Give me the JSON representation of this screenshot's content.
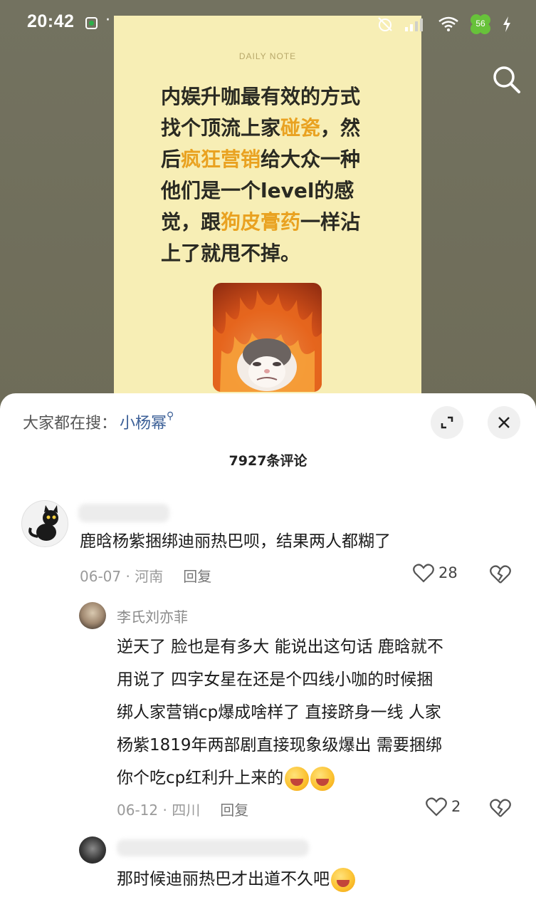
{
  "status_bar": {
    "time": "20:42",
    "dots": "·",
    "battery": "56"
  },
  "note": {
    "header": "DAILY NOTE",
    "lines": [
      [
        {
          "t": "内娱升咖最有效的方式",
          "h": false
        }
      ],
      [
        {
          "t": "找个顶流上家",
          "h": false
        },
        {
          "t": "碰瓷",
          "h": true
        },
        {
          "t": "，然",
          "h": false
        }
      ],
      [
        {
          "t": "后",
          "h": false
        },
        {
          "t": "疯狂营销",
          "h": true
        },
        {
          "t": "给大众一种",
          "h": false
        }
      ],
      [
        {
          "t": "他们是一个level的感",
          "h": false
        }
      ],
      [
        {
          "t": "觉，跟",
          "h": false
        },
        {
          "t": "狗皮膏药",
          "h": true
        },
        {
          "t": "一样沾",
          "h": false
        }
      ],
      [
        {
          "t": "上了就甩不掉。",
          "h": false
        }
      ]
    ]
  },
  "sheet": {
    "hot_search_label": "大家都在搜：",
    "hot_search_keyword": "小杨幂",
    "comment_count": "7927条评论"
  },
  "comments": [
    {
      "text": "鹿晗杨紫捆绑迪丽热巴呗，结果两人都糊了",
      "date": "06-07",
      "location": "河南",
      "reply_label": "回复",
      "likes": "28"
    }
  ],
  "replies": [
    {
      "name": "李氏刘亦菲",
      "lines": [
        "逆天了 脸也是有多大 能说出这句话 鹿晗就不",
        "用说了 四字女星在还是个四线小咖的时候捆",
        "绑人家营销cp爆成啥样了 直接跻身一线 人家",
        "杨紫1819年两部剧直接现象级爆出 需要捆绑",
        "你个吃cp红利升上来的"
      ],
      "date": "06-12",
      "location": "四川",
      "reply_label": "回复",
      "likes": "2"
    },
    {
      "text": "那时候迪丽热巴才出道不久吧"
    }
  ],
  "colors": {
    "highlight": "#e9a221",
    "link": "#3b5f97",
    "note_bg": "#f7eeb5"
  }
}
